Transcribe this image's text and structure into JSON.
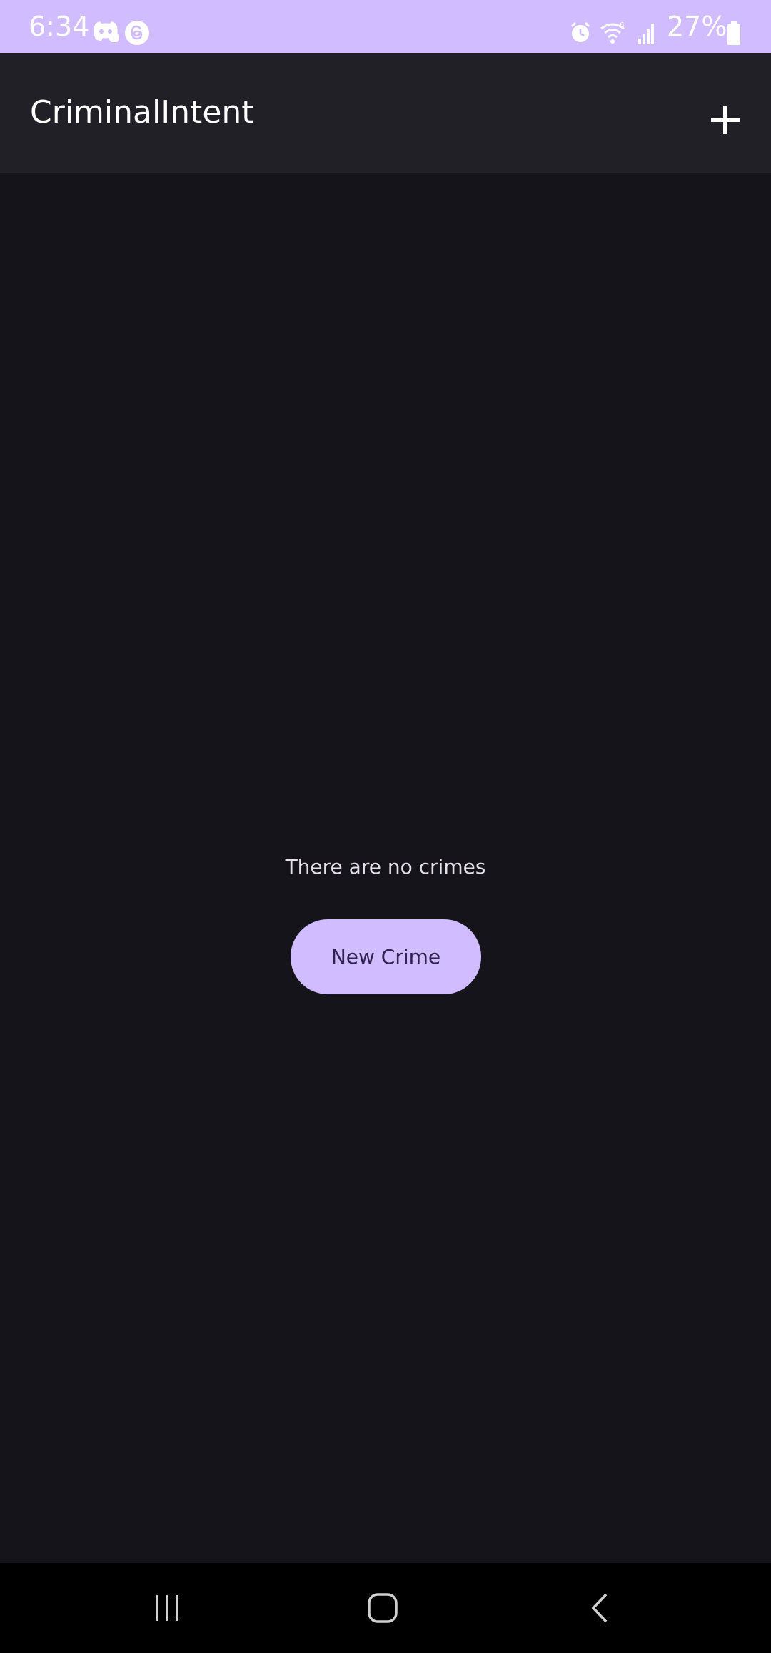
{
  "status_bar": {
    "time": "6:34",
    "battery": "27%",
    "left_icons": [
      "discord-icon",
      "threads-icon"
    ],
    "right_icons": [
      "alarm-icon",
      "wifi-icon",
      "signal-icon",
      "battery-icon"
    ],
    "color": "#d0bcff"
  },
  "app_bar": {
    "title": "CriminalIntent",
    "action_icon": "add-icon",
    "background": "#212026"
  },
  "main": {
    "empty_message": "There are no crimes",
    "new_crime_label": "New Crime",
    "background": "#16141b"
  },
  "nav_bar": {
    "buttons": [
      "recents-icon",
      "home-icon",
      "back-icon"
    ]
  },
  "colors": {
    "accent": "#d0bcff",
    "on_accent": "#302351"
  }
}
